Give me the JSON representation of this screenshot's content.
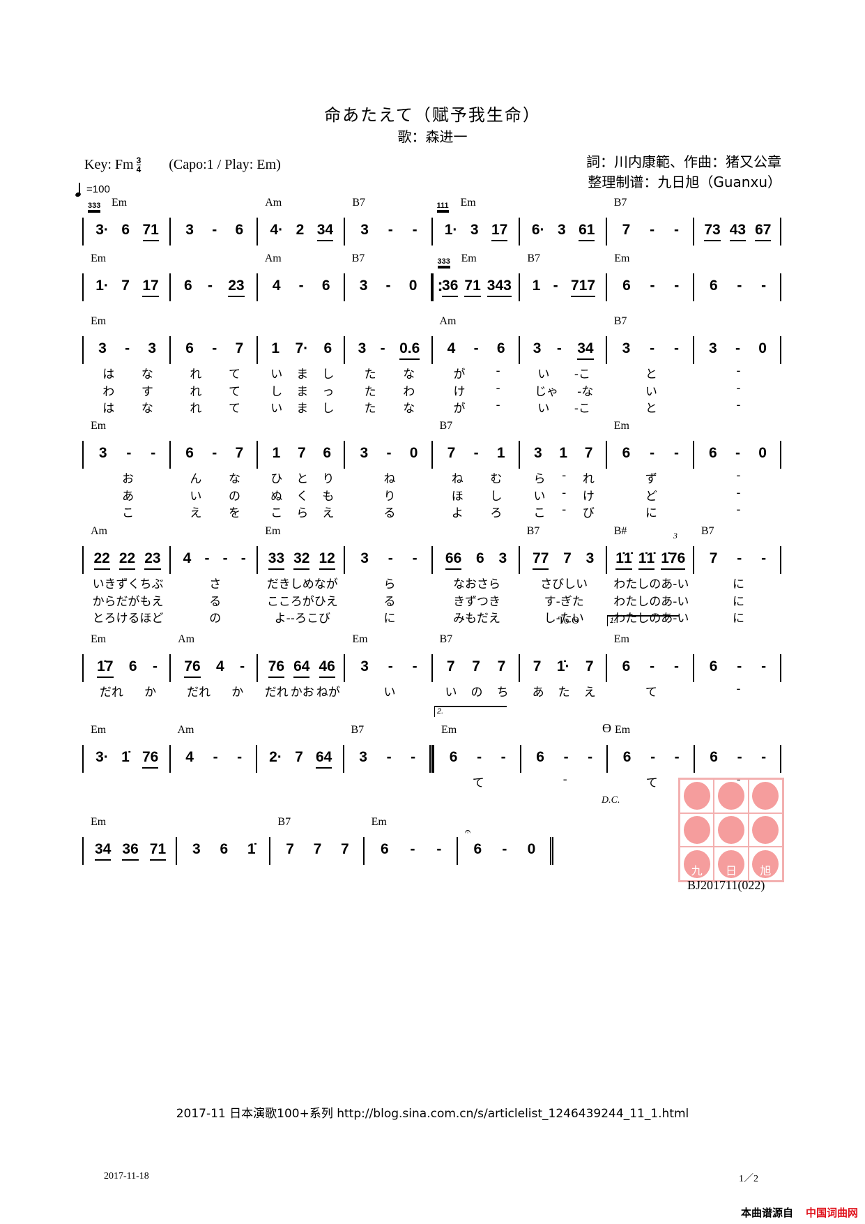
{
  "header": {
    "title": "命あたえて（赋予我生命）",
    "singer": "歌：森进一",
    "key": "Key: Fm",
    "time_signature": {
      "top": "3",
      "bottom": "4"
    },
    "capo": "(Capo:1 / Play: Em)",
    "tempo": "=100",
    "lyricist_composer": "詞：川内康範、作曲：猪又公章",
    "arranger": "整理制谱：九日旭（Guanxu）"
  },
  "rows": [
    {
      "measures": [
        {
          "chord": "Em",
          "grace": "333",
          "notes": "3· 6 71"
        },
        {
          "chord": "",
          "notes": "3 - 6"
        },
        {
          "chord": "Am",
          "notes": "4· 2 34"
        },
        {
          "chord": "B7",
          "notes": "3 - -"
        },
        {
          "chord": "Em",
          "grace": "111",
          "notes": "1· 3 17"
        },
        {
          "chord": "",
          "notes": "6· 3 61"
        },
        {
          "chord": "B7",
          "notes": "7 - -"
        },
        {
          "chord": "",
          "notes": "73 43 67"
        }
      ]
    },
    {
      "measures": [
        {
          "chord": "Em",
          "notes": "1· 7 17"
        },
        {
          "chord": "",
          "notes": "6 - 23"
        },
        {
          "chord": "Am",
          "notes": "4 - 6"
        },
        {
          "chord": "B7",
          "notes": "3 - 0"
        },
        {
          "chord": "Em",
          "grace": "333",
          "notes": "36 71 343",
          "repeat_start": true
        },
        {
          "chord": "B7",
          "notes": "1 - 717"
        },
        {
          "chord": "Em",
          "notes": "6 - -"
        },
        {
          "chord": "",
          "notes": "6 - -"
        }
      ]
    },
    {
      "measures": [
        {
          "chord": "Em",
          "notes": "3 - 3",
          "lyrics": [
            "は な",
            "わ す",
            "は な"
          ]
        },
        {
          "chord": "",
          "notes": "6 - 7",
          "lyrics": [
            "れ て",
            "れ て",
            "れ て"
          ]
        },
        {
          "chord": "",
          "notes": "1 7· 6",
          "lyrics": [
            "い ま し",
            "し ま っ",
            "い ま し"
          ]
        },
        {
          "chord": "",
          "notes": "3 - 0.6",
          "lyrics": [
            "た な",
            "た わ",
            "た な"
          ]
        },
        {
          "chord": "Am",
          "notes": "4 - 6",
          "lyrics": [
            "が -",
            "け -",
            "が -"
          ]
        },
        {
          "chord": "",
          "notes": "3 - 34",
          "lyrics": [
            "い -こ",
            "じゃ -な",
            "い -こ"
          ]
        },
        {
          "chord": "B7",
          "notes": "3 - -",
          "lyrics": [
            "と",
            "い",
            "と"
          ]
        },
        {
          "chord": "",
          "notes": "3 - 0",
          "lyrics": [
            "-",
            "-",
            "-"
          ]
        }
      ]
    },
    {
      "measures": [
        {
          "chord": "Em",
          "notes": "3 - -",
          "lyrics": [
            "お",
            "あ",
            "こ"
          ]
        },
        {
          "chord": "",
          "notes": "6 - 7",
          "lyrics": [
            "ん な",
            "い の",
            "え を"
          ]
        },
        {
          "chord": "",
          "notes": "1 7 6",
          "lyrics": [
            "ひ と り",
            "ぬ く も",
            "こ ら え"
          ]
        },
        {
          "chord": "",
          "notes": "3 - 0",
          "lyrics": [
            "ね",
            "り",
            "る"
          ]
        },
        {
          "chord": "B7",
          "notes": "7 - 1",
          "lyrics": [
            "ね む",
            "ほ し",
            "よ ろ"
          ]
        },
        {
          "chord": "",
          "notes": "3 1 7",
          "lyrics": [
            "ら - れ",
            "い - け",
            "こ - び"
          ]
        },
        {
          "chord": "Em",
          "notes": "6 - -",
          "lyrics": [
            "ず",
            "ど",
            "に"
          ]
        },
        {
          "chord": "",
          "notes": "6 - 0",
          "lyrics": [
            "-",
            "-",
            "-"
          ]
        }
      ]
    },
    {
      "measures": [
        {
          "chord": "Am",
          "notes": "22 22 23",
          "lyrics": [
            "いきずくちぶ",
            "からだがもえ",
            "とろけるほど"
          ]
        },
        {
          "chord": "",
          "notes": "4 - - -",
          "lyrics": [
            "さ",
            "る",
            "の"
          ]
        },
        {
          "chord": "Em",
          "notes": "33 32 12",
          "lyrics": [
            "だきしめなが",
            "こころがひえ",
            "よ--ろこび"
          ]
        },
        {
          "chord": "",
          "notes": "3 - -",
          "lyrics": [
            "ら",
            "る",
            "に"
          ]
        },
        {
          "chord": "",
          "notes": "66 6 3",
          "lyrics": [
            "なおさら",
            "きずつき",
            "みもだえ"
          ]
        },
        {
          "chord": "B7",
          "notes": "77 7 3",
          "lyrics": [
            "さびしい",
            "す-ぎた",
            "し-たい"
          ]
        },
        {
          "chord": "B#",
          "notes": "1̇1̇ 1̇1̇ 1̇76",
          "triplet": "3",
          "lyrics": [
            "わたしのあ-い",
            "わたしのあ-い",
            "わたしのあ-い"
          ]
        },
        {
          "chord": "B7",
          "notes": "7 - -",
          "lyrics": [
            "に",
            "に",
            "に"
          ]
        }
      ]
    },
    {
      "measures": [
        {
          "chord": "Em",
          "notes": "1̇7 6 -",
          "lyrics": [
            "だれ か"
          ]
        },
        {
          "chord": "Am",
          "notes": "76 4 -",
          "lyrics": [
            "だれ か"
          ]
        },
        {
          "chord": "",
          "notes": "76 64 46",
          "lyrics": [
            "だれ かお ねが"
          ]
        },
        {
          "chord": "Em",
          "notes": "3 - -",
          "lyrics": [
            "い"
          ]
        },
        {
          "chord": "B7",
          "notes": "7 7 7",
          "lyrics": [
            "い の ち"
          ]
        },
        {
          "chord": "",
          "notes": "7 1̇· 7",
          "lyrics": [
            "あ た え"
          ]
        },
        {
          "chord": "Em",
          "notes": "6 - -",
          "volta": "1.",
          "to_coda": "To",
          "lyrics": [
            "て"
          ]
        },
        {
          "chord": "",
          "notes": "6 - -",
          "lyrics": [
            "-"
          ]
        }
      ]
    },
    {
      "measures": [
        {
          "chord": "Em",
          "notes": "3· 1̇ 76"
        },
        {
          "chord": "Am",
          "notes": "4 - -"
        },
        {
          "chord": "",
          "notes": "2· 7 64"
        },
        {
          "chord": "B7",
          "notes": "3 - -",
          "repeat_end": true
        },
        {
          "chord": "Em",
          "notes": "6 - -",
          "volta": "2.",
          "lyrics": [
            "て"
          ]
        },
        {
          "chord": "",
          "notes": "6 - -",
          "lyrics": [
            "-"
          ]
        },
        {
          "chord": "Em",
          "notes": "6 - -",
          "coda": true,
          "lyrics": [
            "て"
          ]
        },
        {
          "chord": "",
          "notes": "6 - -",
          "lyrics": [
            "-"
          ]
        }
      ]
    },
    {
      "measures": [
        {
          "chord": "Em",
          "notes": "34 36 71"
        },
        {
          "chord": "",
          "notes": "3 6 1̇"
        },
        {
          "chord": "B7",
          "notes": "7 7 7"
        },
        {
          "chord": "Em",
          "notes": "6 - -"
        },
        {
          "chord": "",
          "notes": "6 - 0",
          "fermata": true,
          "final": true
        }
      ]
    }
  ],
  "marks": {
    "dc": "D.C.",
    "coda_symbol": "ϴ"
  },
  "stamp": {
    "text": [
      "九",
      "日",
      "旭"
    ],
    "color": "#f59d9d"
  },
  "code": "BJ201711(022)",
  "footer": "2017-11 日本演歌100+系列  http://blog.sina.com.cn/s/articlelist_1246439244_11_1.html",
  "date": "2017-11-18",
  "page": "1／2",
  "source": {
    "prefix": "本曲谱源自",
    "site": "中国词曲网",
    "site_color": "#e0101a"
  }
}
